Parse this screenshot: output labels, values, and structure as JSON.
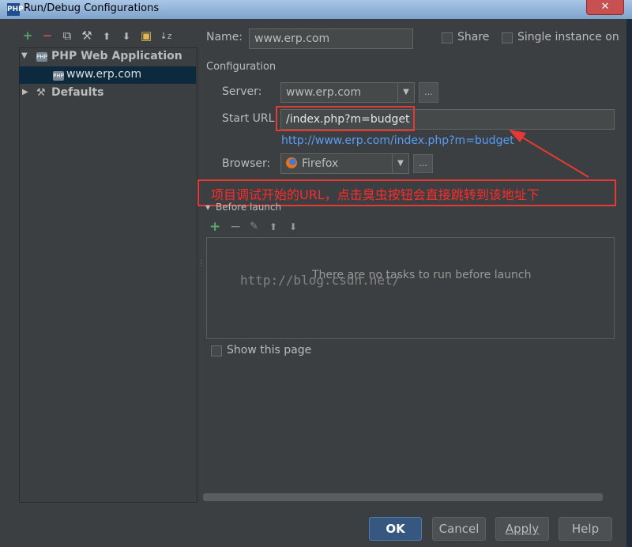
{
  "window": {
    "title": "Run/Debug Configurations",
    "app_icon": "PHP",
    "close_glyph": "✕"
  },
  "toolbar": {
    "add": "+",
    "remove": "−",
    "copy": "⧉",
    "edit": "⚒",
    "up": "⬆",
    "down": "⬇",
    "folder": "▣",
    "sort": "↓z"
  },
  "tree": {
    "php_group": {
      "arrow": "▼",
      "label": "PHP Web Application"
    },
    "config_item": {
      "label": "www.erp.com"
    },
    "defaults": {
      "arrow": "▶",
      "label": "Defaults"
    }
  },
  "form": {
    "name_label": "Name:",
    "name_value": "www.erp.com",
    "share_label": "Share",
    "single_instance_label": "Single instance on",
    "configuration_label": "Configuration",
    "server_label": "Server:",
    "server_value": "www.erp.com",
    "start_url_label": "Start URL:",
    "start_url_value": "/index.php?m=budget",
    "full_url": "http://www.erp.com/index.php?m=budget",
    "browser_label": "Browser:",
    "browser_value": "Firefox",
    "ellipsis": "...",
    "dropdown_arrow": "▼"
  },
  "annotation": {
    "text": "项目调试开始的URL，点击臭虫按钮会直接跳转到该地址下"
  },
  "before_launch": {
    "label": "Before launch",
    "arrow": "▼",
    "empty_text": "There are no tasks to run before launch",
    "add": "+",
    "remove": "−",
    "edit": "✎",
    "up": "⬆",
    "down": "⬇"
  },
  "watermark": "http://blog.csdn.net/",
  "show_this_page_label": "Show this page",
  "buttons": {
    "ok": "OK",
    "cancel": "Cancel",
    "apply": "Apply",
    "help": "Help"
  },
  "colors": {
    "bg": "#3c3f41",
    "link": "#589df6",
    "annotation": "#e53935",
    "selection": "#0d293e"
  }
}
